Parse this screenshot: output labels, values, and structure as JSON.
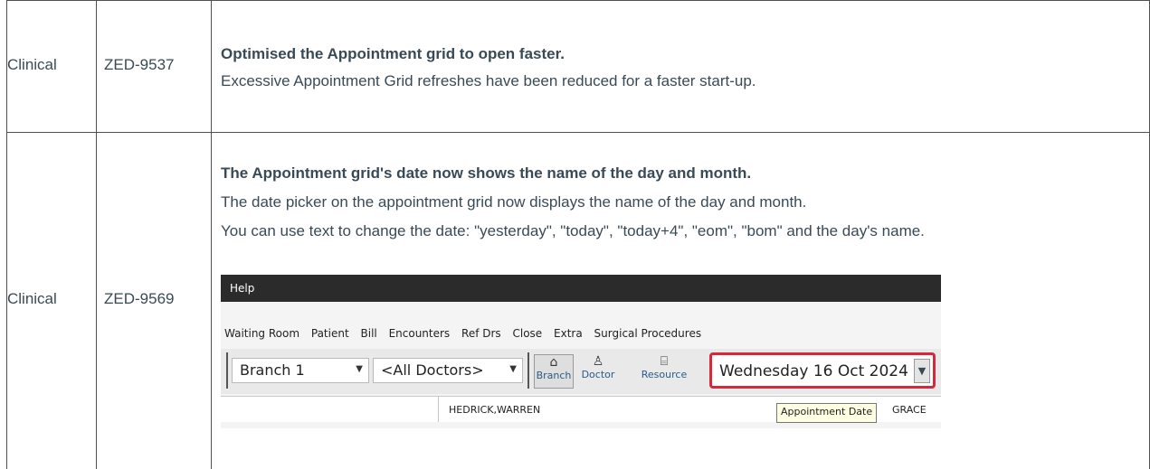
{
  "rows": [
    {
      "category": "Clinical",
      "ticket": "ZED-9537",
      "title": "Optimised the Appointment grid to open faster.",
      "lines": [
        "Excessive Appointment Grid refreshes have been reduced for a faster start-up."
      ]
    },
    {
      "category": "Clinical",
      "ticket": "ZED-9569",
      "title": "The Appointment grid's date now shows the name of the day and month.",
      "lines": [
        "The date picker on the appointment grid now displays the name of the day and month.",
        "You can use text to change the date: \"yesterday\", \"today\", \"today+4\", \"eom\", \"bom\" and the day's name."
      ]
    }
  ],
  "screenshot": {
    "title_bar": "Help",
    "menu": [
      "Waiting Room",
      "Patient",
      "Bill",
      "Encounters",
      "Ref Drs",
      "Close",
      "Extra",
      "Surgical Procedures"
    ],
    "branch_select": "Branch 1",
    "doctor_select": "<All Doctors>",
    "buttons": {
      "branch": "Branch",
      "doctor": "Doctor",
      "resource": "Resource"
    },
    "date_value": "Wednesday 16 Oct 2024",
    "column_name": "HEDRICK,WARREN",
    "column_name2": "GRACE",
    "tooltip": "Appointment Date",
    "highlight_color": "#d6273b"
  }
}
